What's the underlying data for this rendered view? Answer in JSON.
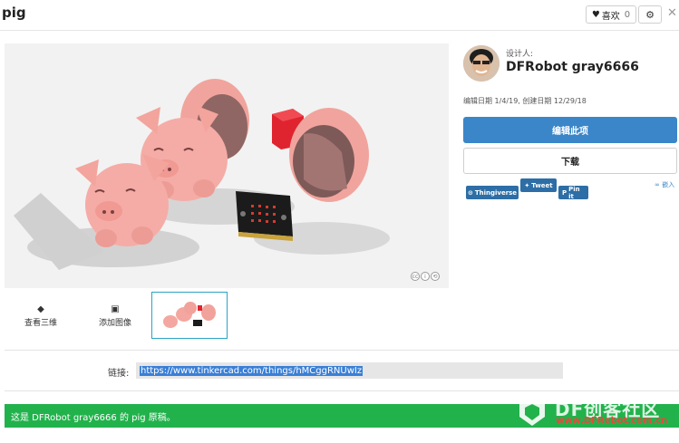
{
  "header": {
    "title": "pig",
    "like_label": "喜欢",
    "like_count": "0"
  },
  "thumbnails": {
    "view_3d_label": "查看三维",
    "add_image_label": "添加图像"
  },
  "designer": {
    "label": "设计人:",
    "name": "DFRobot gray6666",
    "dates": "编辑日期 1/4/19, 创建日期 12/29/18"
  },
  "actions": {
    "edit_label": "编辑此项",
    "download_label": "下载"
  },
  "share": {
    "thingiverse": "Thingiverse",
    "tweet": "Tweet",
    "pin": "Pin it",
    "embed": "嵌入"
  },
  "link": {
    "label": "链接:",
    "url": "https://www.tinkercad.com/things/hMCggRNUwIz"
  },
  "description": "这是 DFRobot gray6666 的 pig 原稿。",
  "watermark": {
    "brand": "DF创客社区",
    "url": "www.DFRobot.com.cn"
  },
  "colors": {
    "accent": "#3b86c9",
    "banner": "#22b24c",
    "pig": "#f2a7a0"
  }
}
